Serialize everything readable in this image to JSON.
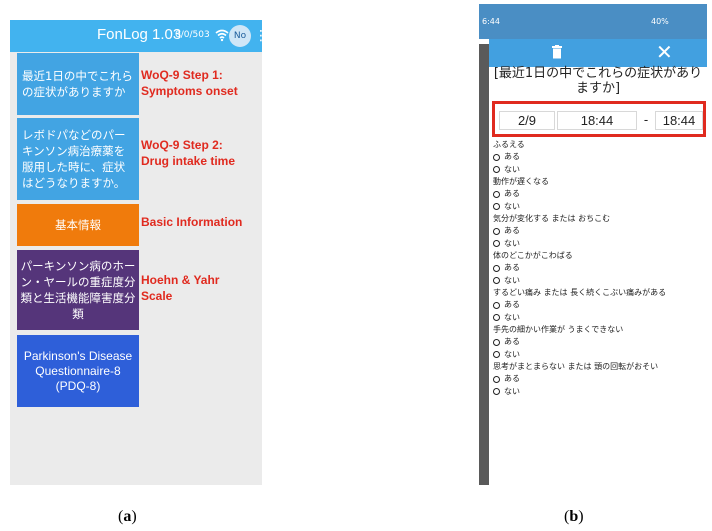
{
  "panel_a": {
    "app_title": "FonLog 1.03",
    "counter": "0/0/503",
    "user_badge": "No",
    "buttons": [
      {
        "label": "最近1日の中でこれらの症状がありますか",
        "annotation": "WoQ-9 Step 1:\nSymptoms onset",
        "color": "#42a4e3"
      },
      {
        "label": "レボドパなどのパーキンソン病治療薬を服用した時に、症状はどうなりますか。",
        "annotation": "WoQ-9 Step 2:\nDrug intake time",
        "color": "#42a4e3"
      },
      {
        "label": "基本情報",
        "annotation": "Basic Information",
        "color": "#f07b0c"
      },
      {
        "label": "パーキンソン病のホーン・ヤールの重症度分類と生活機能障害度分類",
        "annotation": "Hoehn & Yahr\nScale",
        "color": "#55357a"
      },
      {
        "label": "Parkinson's Disease Questionnaire-8 (PDQ-8)",
        "color": "#2e5fd9"
      }
    ],
    "caption_letter": "a"
  },
  "panel_b": {
    "status_time": "6:44",
    "status_icons": "40%",
    "question": "[最近1日の中でこれらの症状がありますか]",
    "date": "2/9",
    "time_start": "18:44",
    "dash": "-",
    "time_end": "18:44",
    "symptoms": [
      "ふるえる",
      "動作が遅くなる",
      "気分が変化する または おちこむ",
      "体のどこかがこわばる",
      "するどい痛み または 長く続くこぶい痛みがある",
      "手先の細かい作業が うまくできない",
      "思考がまとまらない または 頭の回転がおそい"
    ],
    "option_yes": "ある",
    "option_no": "ない",
    "caption_letter": "b"
  },
  "colors": {
    "accent": "#42b3ef",
    "annotation": "#e02a1f",
    "highlight_box": "#e02a1f"
  }
}
